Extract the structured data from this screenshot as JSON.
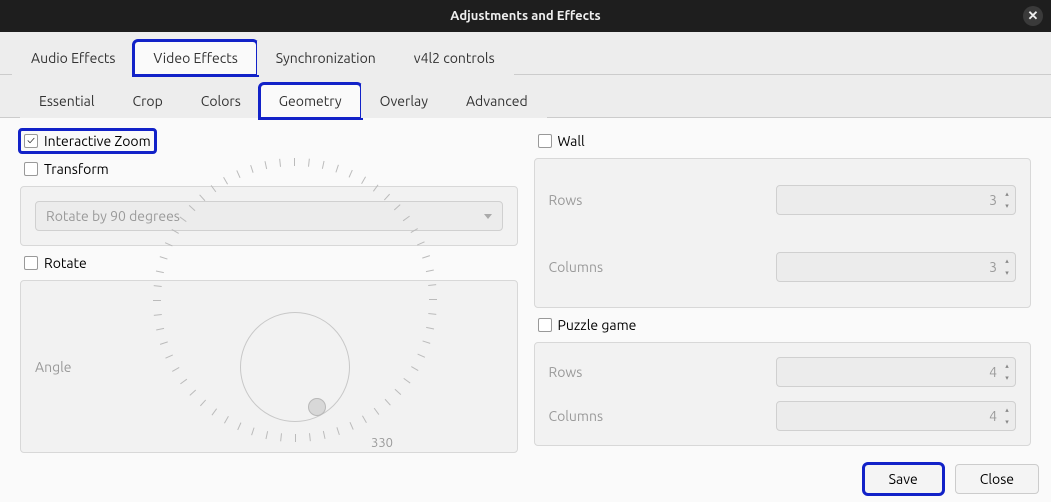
{
  "window": {
    "title": "Adjustments and Effects"
  },
  "tabs_top": [
    "Audio Effects",
    "Video Effects",
    "Synchronization",
    "v4l2 controls"
  ],
  "tabs_top_active": 1,
  "tabs_sub": [
    "Essential",
    "Crop",
    "Colors",
    "Geometry",
    "Overlay",
    "Advanced"
  ],
  "tabs_sub_active": 3,
  "left": {
    "interactive_zoom": {
      "label": "Interactive Zoom",
      "checked": true
    },
    "transform": {
      "label": "Transform",
      "checked": false,
      "combo": "Rotate by 90 degrees"
    },
    "rotate": {
      "label": "Rotate",
      "checked": false,
      "angle_label": "Angle",
      "angle_value": "330"
    }
  },
  "right": {
    "wall": {
      "label": "Wall",
      "checked": false,
      "rows_label": "Rows",
      "rows_value": "3",
      "cols_label": "Columns",
      "cols_value": "3"
    },
    "puzzle": {
      "label": "Puzzle game",
      "checked": false,
      "rows_label": "Rows",
      "rows_value": "4",
      "cols_label": "Columns",
      "cols_value": "4"
    }
  },
  "footer": {
    "save": "Save",
    "close": "Close"
  }
}
